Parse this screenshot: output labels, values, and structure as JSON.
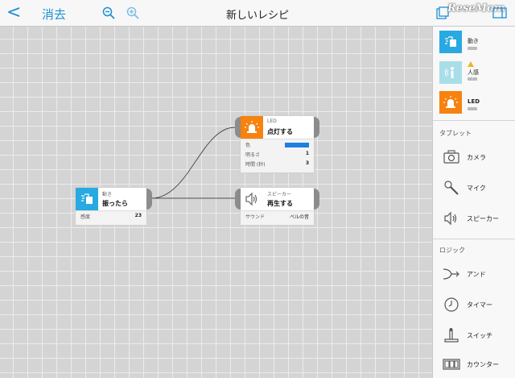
{
  "topbar": {
    "back_glyph": "<",
    "delete_label": "消去",
    "zoom_out_icon": "zoom-out-icon",
    "zoom_in_icon": "zoom-in-icon",
    "title": "新しいレシピ",
    "watermark": "ReseMom"
  },
  "colors": {
    "accent": "#1e8fd6",
    "motion": "#29a9e1",
    "led": "#f7820f",
    "human": "#a9dee8",
    "led_color_swatch": "#1e7fe0"
  },
  "nodes": {
    "motion": {
      "type": "動き",
      "action": "振ったら",
      "props": [
        {
          "label": "感度",
          "value": "23"
        }
      ]
    },
    "led": {
      "type": "LED",
      "action": "点灯する",
      "props": [
        {
          "label": "色",
          "value": ""
        },
        {
          "label": "明るさ",
          "value": "1"
        },
        {
          "label": "時間 (秒)",
          "value": "3"
        }
      ]
    },
    "speaker": {
      "type": "スピーカー",
      "action": "再生する",
      "props": [
        {
          "label": "サウンド",
          "value": "ベルの音"
        }
      ]
    }
  },
  "sidebar": {
    "devices": [
      {
        "label": "動き",
        "icon": "motion-icon"
      },
      {
        "label": "人感",
        "icon": "human-sensor-icon",
        "sub": "?"
      },
      {
        "label": "LED",
        "icon": "led-icon"
      }
    ],
    "tablet_title": "タブレット",
    "tablet_items": [
      {
        "label": "カメラ",
        "icon": "camera-icon"
      },
      {
        "label": "マイク",
        "icon": "microphone-icon"
      },
      {
        "label": "スピーカー",
        "icon": "speaker-icon"
      }
    ],
    "logic_title": "ロジック",
    "logic_items": [
      {
        "label": "アンド",
        "icon": "and-icon"
      },
      {
        "label": "タイマー",
        "icon": "timer-icon"
      },
      {
        "label": "スイッチ",
        "icon": "switch-icon"
      },
      {
        "label": "カウンター",
        "icon": "counter-icon"
      }
    ]
  }
}
